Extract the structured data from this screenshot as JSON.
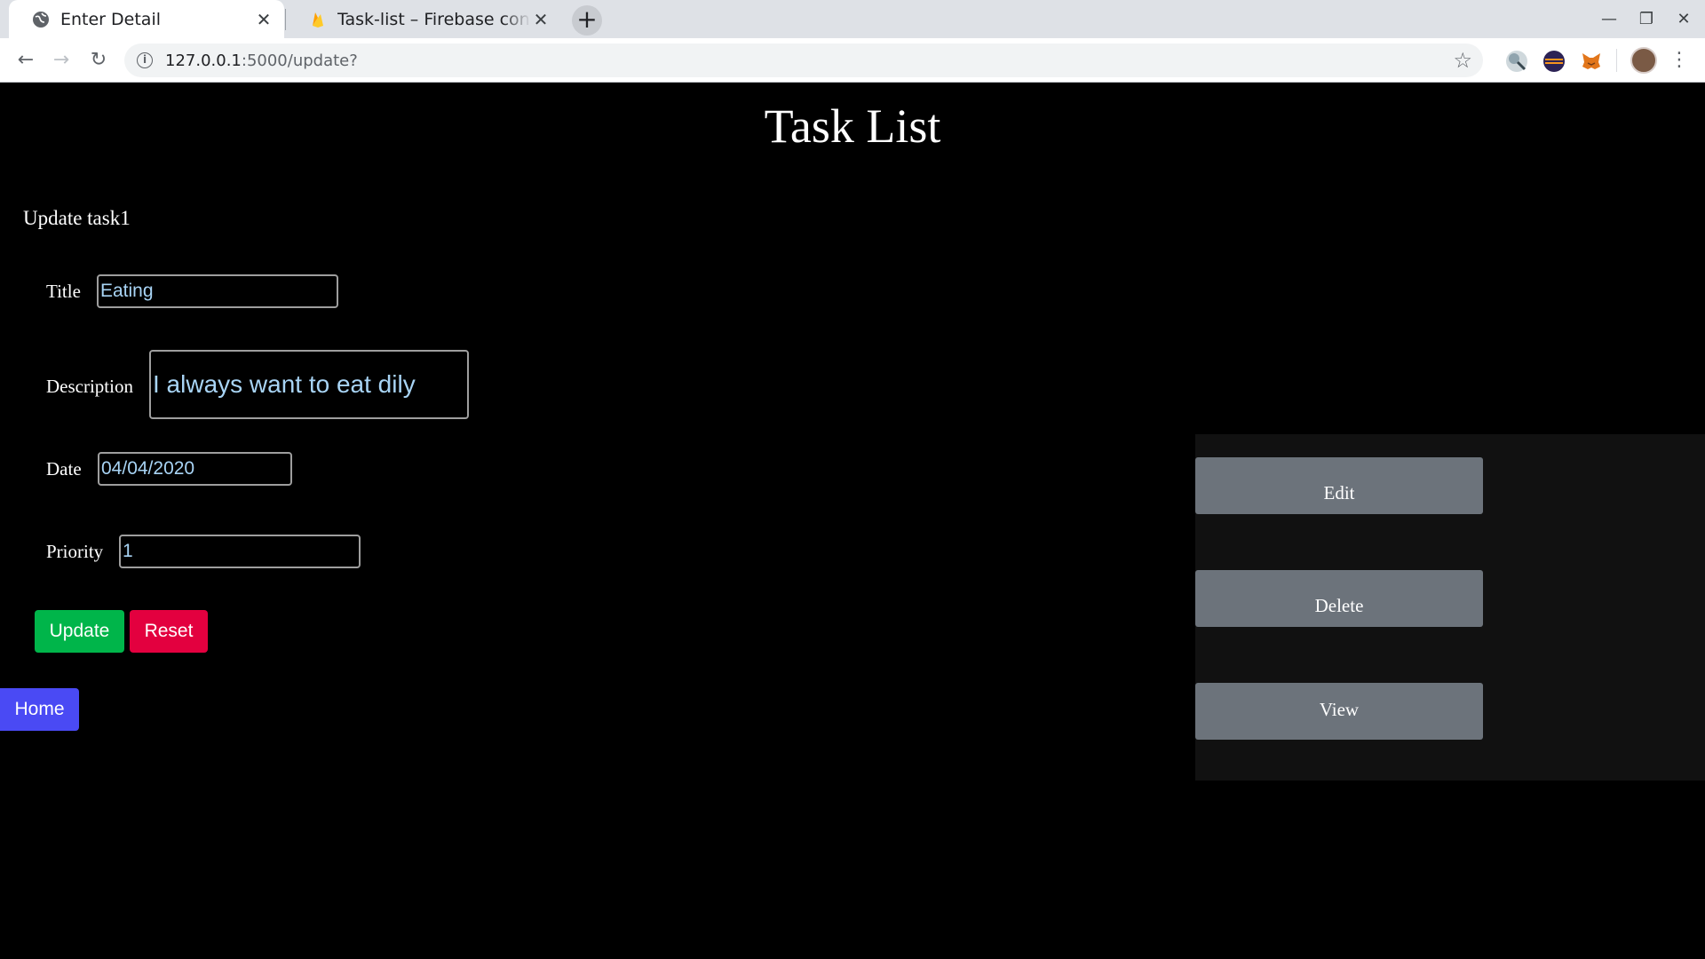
{
  "browser": {
    "tabs": [
      {
        "title": "Enter Detail",
        "favicon": "globe-icon",
        "active": true
      },
      {
        "title": "Task-list – Firebase console",
        "favicon": "firebase-icon",
        "active": false
      }
    ],
    "url_host": "127.0.0.1",
    "url_path": ":5000/update?",
    "extensions": [
      "magnifier-extension-icon",
      "eclipse-extension-icon",
      "metamask-fox-icon"
    ],
    "colors": {
      "tabstrip": "#dee1e6",
      "toolbar": "#ffffff"
    }
  },
  "page": {
    "title": "Task List",
    "form_heading": "Update task1",
    "fields": {
      "title": {
        "label": "Title",
        "value": "Eating"
      },
      "description": {
        "label": "Description",
        "value": "I always want to eat dily"
      },
      "date": {
        "label": "Date",
        "value": "04/04/2020"
      },
      "priority": {
        "label": "Priority",
        "value": "1"
      }
    },
    "buttons": {
      "update": "Update",
      "reset": "Reset",
      "home": "Home"
    },
    "side_actions": {
      "edit": "Edit",
      "delete": "Delete",
      "view": "View"
    },
    "colors": {
      "background": "#000000",
      "input_text": "#a8d4f5",
      "update": "#00b54a",
      "reset": "#e3003f",
      "home": "#4a4af4",
      "side_button": "#6c737b",
      "side_panel": "#111111"
    }
  }
}
